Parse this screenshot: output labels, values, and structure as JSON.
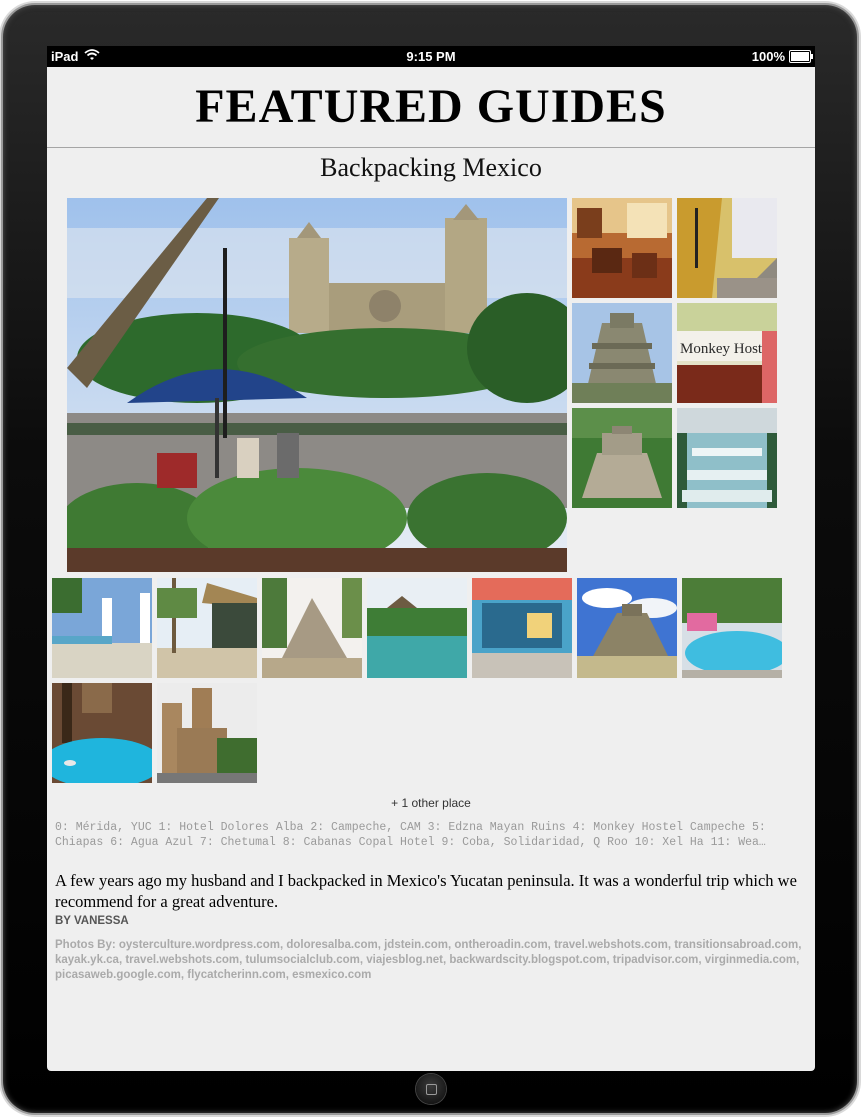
{
  "status_bar": {
    "device": "iPad",
    "time": "9:15 PM",
    "battery": "100%",
    "wifi_icon": "wifi-icon",
    "battery_icon": "battery-icon"
  },
  "page": {
    "title": "FEATURED GUIDES"
  },
  "guide": {
    "title": "Backpacking Mexico",
    "more_places": "+ 1 other place",
    "place_list": "0: Mérida, YUC 1: Hotel Dolores Alba 2: Campeche, CAM 3: Edzna Mayan Ruins 4: Monkey Hostel Campeche 5: Chiapas 6: Agua Azul 7: Chetumal 8: Cabanas Copal Hotel 9: Coba, Solidaridad, Q Roo 10: Xel Ha 11: Wea…",
    "description": "A few years ago my husband and I backpacked in Mexico's Yucatan peninsula.  It was a wonderful trip which we recommend for a great adventure.",
    "byline": "BY VANESSA",
    "credits": "Photos By: oysterculture.wordpress.com, doloresalba.com, jdstein.com, ontheroadin.com, travel.webshots.com, transitionsabroad.com, kayak.yk.ca, travel.webshots.com, tulumsocialclub.com, viajesblog.net, backwardscity.blogspot.com, tripadvisor.com, virginmedia.com, picasaweb.google.com, flycatcherinn.com, esmexico.com",
    "photo_sign": "Monkey Hostel"
  },
  "colors": {
    "screen_bg": "#efefef",
    "sky": "#9ec3ef",
    "foliage": "#2f6a2a",
    "water": "#3fb6d6",
    "stone": "#a8a190"
  }
}
